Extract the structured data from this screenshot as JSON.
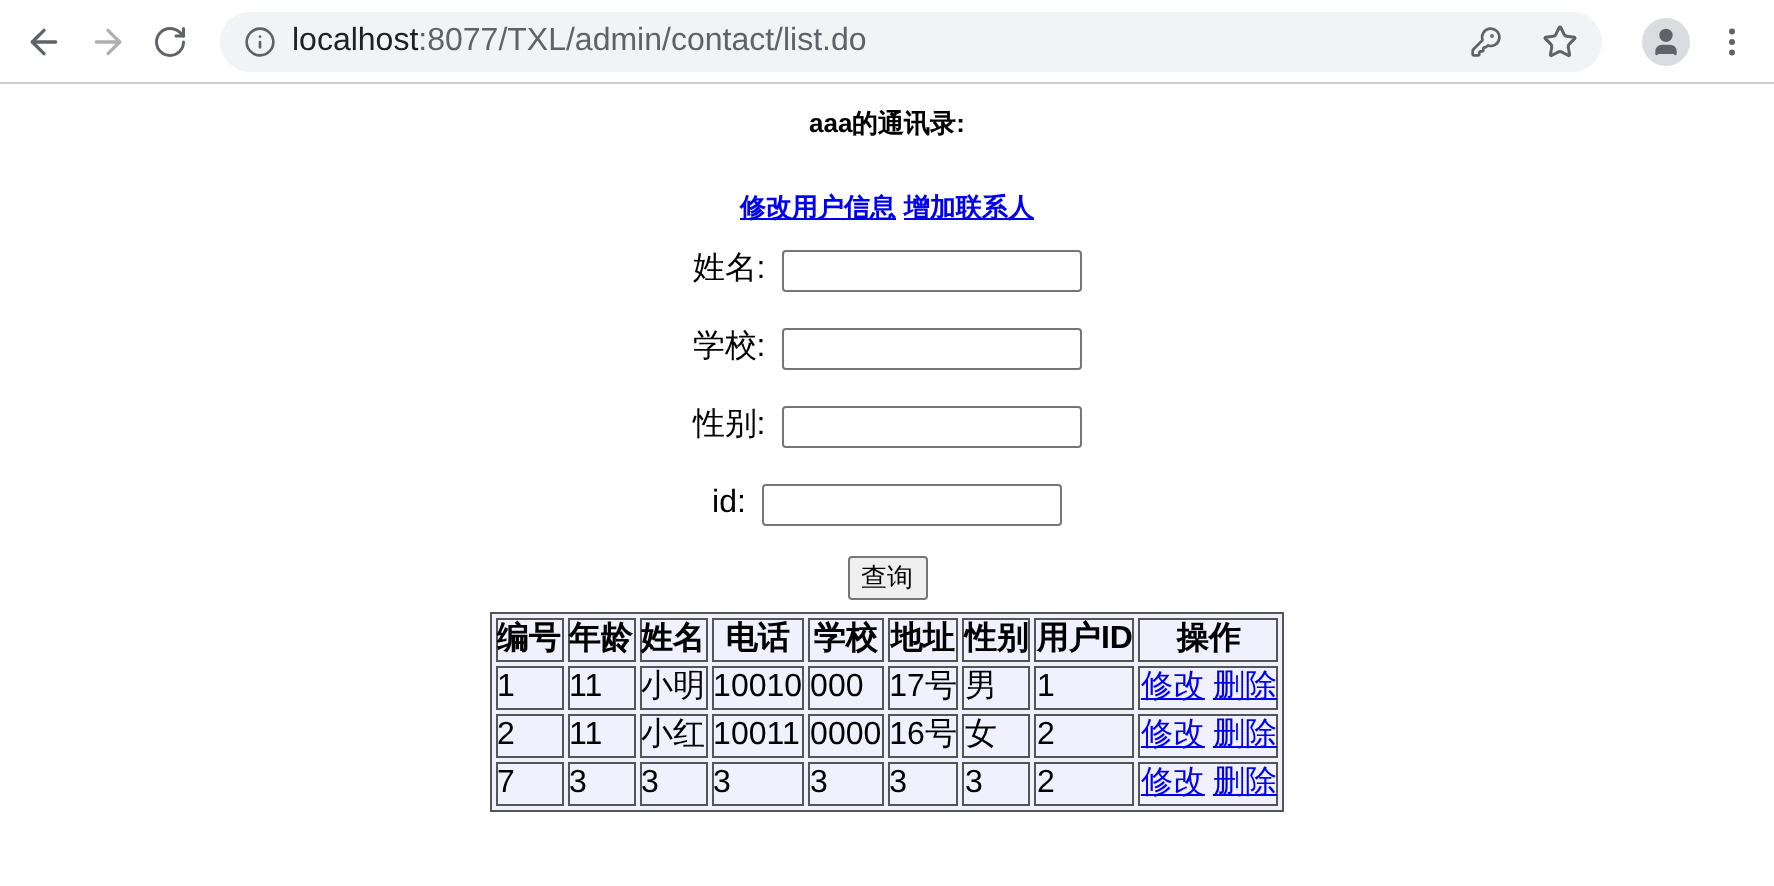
{
  "browser": {
    "url_host": "localhost",
    "url_rest": ":8077/TXL/admin/contact/list.do"
  },
  "heading": "aaa的通讯录:",
  "links": [
    "修改用户信息",
    "增加联系人"
  ],
  "search_fields": [
    {
      "label": "姓名:"
    },
    {
      "label": "学校:"
    },
    {
      "label": "性别:"
    },
    {
      "label": "id:"
    }
  ],
  "search_button": "查询",
  "table": {
    "columns": [
      "编号",
      "年龄",
      "姓名",
      "电话",
      "学校",
      "地址",
      "性别",
      "用户ID",
      "操作"
    ],
    "rows": [
      {
        "cells": [
          "1",
          "11",
          "小明",
          "10010",
          "000",
          "17号",
          "男",
          "1"
        ],
        "actions": [
          "修改",
          "删除"
        ]
      },
      {
        "cells": [
          "2",
          "11",
          "小红",
          "10011",
          "0000",
          "16号",
          "女",
          "2"
        ],
        "actions": [
          "修改",
          "删除"
        ]
      },
      {
        "cells": [
          "7",
          "3",
          "3",
          "3",
          "3",
          "3",
          "3",
          "2"
        ],
        "actions": [
          "修改",
          "删除"
        ]
      }
    ]
  }
}
